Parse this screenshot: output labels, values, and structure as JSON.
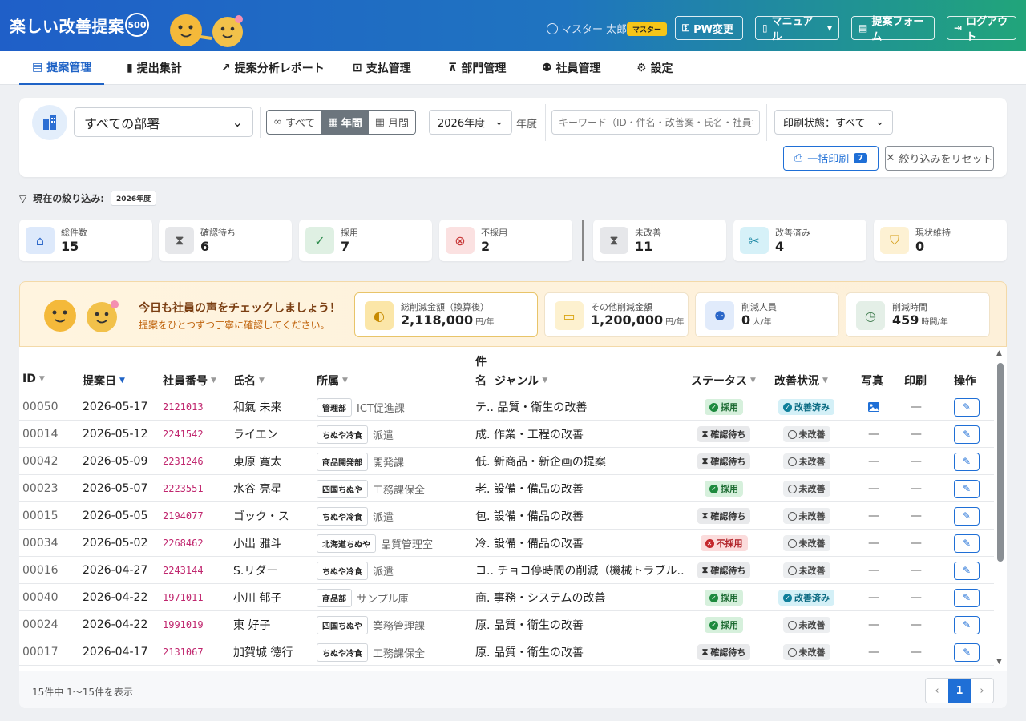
{
  "header": {
    "title": "楽しい改善提案",
    "badge": "500",
    "user_name": "マスター 太郎",
    "role": "マスター",
    "buttons": {
      "pw": "PW変更",
      "manual": "マニュアル",
      "form": "提案フォーム",
      "logout": "ログアウト"
    }
  },
  "tabs": [
    {
      "label": "提案管理"
    },
    {
      "label": "提出集計"
    },
    {
      "label": "提案分析レポート"
    },
    {
      "label": "支払管理"
    },
    {
      "label": "部門管理"
    },
    {
      "label": "社員管理"
    },
    {
      "label": "設定"
    }
  ],
  "filter": {
    "department": "すべての部署",
    "period_all": "すべて",
    "period_year": "年間",
    "period_month": "月間",
    "year": "2026年度",
    "year_unit": "年度",
    "keyword_placeholder": "キーワード（ID・件名・改善案・氏名・社員番号）",
    "print_state": "印刷状態：すべて",
    "bulk_print": "一括印刷",
    "bulk_count": "7",
    "reset": "絞り込みをリセット"
  },
  "current_filter": {
    "label": "現在の絞り込み:",
    "chip": "2026年度"
  },
  "stats": [
    {
      "label": "総件数",
      "value": "15"
    },
    {
      "label": "確認待ち",
      "value": "6"
    },
    {
      "label": "採用",
      "value": "7"
    },
    {
      "label": "不採用",
      "value": "2"
    },
    {
      "label": "未改善",
      "value": "11"
    },
    {
      "label": "改善済み",
      "value": "4"
    },
    {
      "label": "現状維持",
      "value": "0"
    }
  ],
  "banner": {
    "title": "今日も社員の声をチェックしましょう！",
    "subtitle": "提案をひとつずつ丁寧に確認してください。",
    "kpis": [
      {
        "label": "総削減金額（換算後）",
        "value": "2,118,000",
        "unit": "円/年"
      },
      {
        "label": "その他削減金額",
        "value": "1,200,000",
        "unit": "円/年"
      },
      {
        "label": "削減人員",
        "value": "0",
        "unit": "人/年"
      },
      {
        "label": "削減時間",
        "value": "459",
        "unit": "時間/年"
      }
    ]
  },
  "table": {
    "headers": {
      "id": "ID",
      "date": "提案日",
      "emp_no": "社員番号",
      "name": "氏名",
      "dept": "所属",
      "title_top": "件",
      "title_bottom": "名",
      "genre": "ジャンル",
      "status": "ステータス",
      "improvement": "改善状況",
      "photo": "写真",
      "print": "印刷",
      "action": "操作"
    },
    "rows": [
      {
        "id": "00050",
        "date": "2026-05-17",
        "emp": "2121013",
        "name": "和氣 未来",
        "dept": "管理部",
        "section": "ICT促進課",
        "title": "テ.. 品質・衛生の改善",
        "status": "採用",
        "imp": "改善済み",
        "photo": "image",
        "print": "—"
      },
      {
        "id": "00014",
        "date": "2026-05-12",
        "emp": "2241542",
        "name": "ライエン",
        "dept": "ちぬや冷食",
        "section": "派遣",
        "title": "成. 作業・工程の改善",
        "status": "確認待ち",
        "imp": "未改善",
        "photo": "—",
        "print": "—"
      },
      {
        "id": "00042",
        "date": "2026-05-09",
        "emp": "2231246",
        "name": "東原 寛太",
        "dept": "商品開発部",
        "section": "開発課",
        "title": "低. 新商品・新企画の提案",
        "status": "確認待ち",
        "imp": "未改善",
        "photo": "—",
        "print": "—"
      },
      {
        "id": "00023",
        "date": "2026-05-07",
        "emp": "2223551",
        "name": "水谷 亮星",
        "dept": "四国ちぬや",
        "section": "工務課保全",
        "title": "老. 設備・備品の改善",
        "status": "採用",
        "imp": "未改善",
        "photo": "—",
        "print": "—"
      },
      {
        "id": "00015",
        "date": "2026-05-05",
        "emp": "2194077",
        "name": "ゴック・ス",
        "dept": "ちぬや冷食",
        "section": "派遣",
        "title": "包. 設備・備品の改善",
        "status": "確認待ち",
        "imp": "未改善",
        "photo": "—",
        "print": "—"
      },
      {
        "id": "00034",
        "date": "2026-05-02",
        "emp": "2268462",
        "name": "小出 雅斗",
        "dept": "北海道ちぬや",
        "section": "品質管理室",
        "title": "冷. 設備・備品の改善",
        "status": "不採用",
        "imp": "未改善",
        "photo": "—",
        "print": "—"
      },
      {
        "id": "00016",
        "date": "2026-04-27",
        "emp": "2243144",
        "name": "S.リダー",
        "dept": "ちぬや冷食",
        "section": "派遣",
        "title": "コ.. チョコ停時間の削減（機械トラブル…",
        "status": "確認待ち",
        "imp": "未改善",
        "photo": "—",
        "print": "—"
      },
      {
        "id": "00040",
        "date": "2026-04-22",
        "emp": "1971011",
        "name": "小川 郁子",
        "dept": "商品部",
        "section": "サンプル庫",
        "title": "商. 事務・システムの改善",
        "status": "採用",
        "imp": "改善済み",
        "photo": "—",
        "print": "—"
      },
      {
        "id": "00024",
        "date": "2026-04-22",
        "emp": "1991019",
        "name": "東 好子",
        "dept": "四国ちぬや",
        "section": "業務管理課",
        "title": "原. 品質・衛生の改善",
        "status": "採用",
        "imp": "未改善",
        "photo": "—",
        "print": "—"
      },
      {
        "id": "00017",
        "date": "2026-04-17",
        "emp": "2131067",
        "name": "加賀城 徳行",
        "dept": "ちぬや冷食",
        "section": "工務課保全",
        "title": "原. 品質・衛生の改善",
        "status": "確認待ち",
        "imp": "未改善",
        "photo": "—",
        "print": "—"
      }
    ],
    "footer": "15件中 1〜15件を表示",
    "page": "1"
  }
}
